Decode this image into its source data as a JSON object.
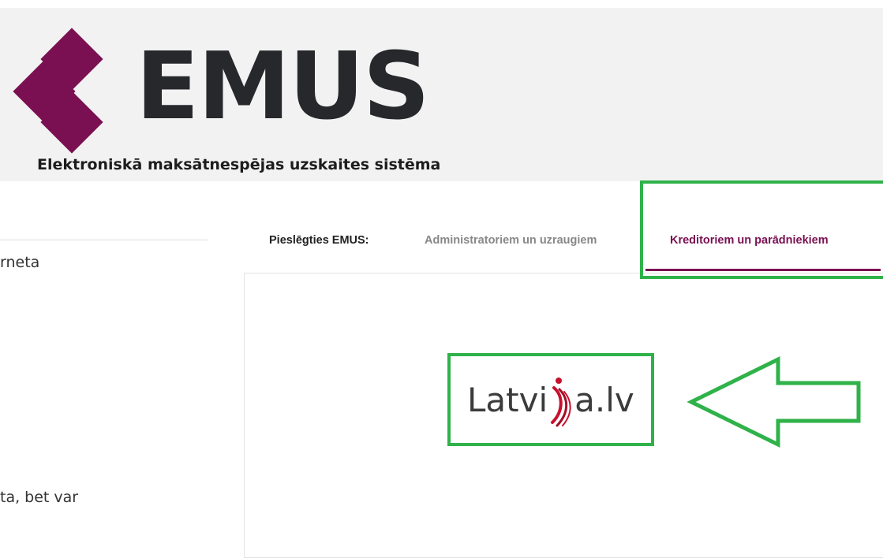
{
  "header": {
    "brand_name": "EMUS",
    "tagline": "Elektroniskā maksātnespējas uzskaites sistēma",
    "accent_color": "#7a1052"
  },
  "left_panel": {
    "text_line_1": "rneta",
    "text_line_2": "ta, bet var"
  },
  "login": {
    "label": "Pieslēgties EMUS:",
    "tabs": [
      {
        "label": "Administratoriem un uzraugiem",
        "active": false
      },
      {
        "label": "Kreditoriem un parādniekiem",
        "active": true
      }
    ]
  },
  "auth_provider": {
    "logo_text_before": "Latvi",
    "logo_text_after": "a.lv"
  },
  "annotations": {
    "highlight_color": "#2fb24a",
    "arrow_icon": "left-arrow-outline-icon"
  }
}
